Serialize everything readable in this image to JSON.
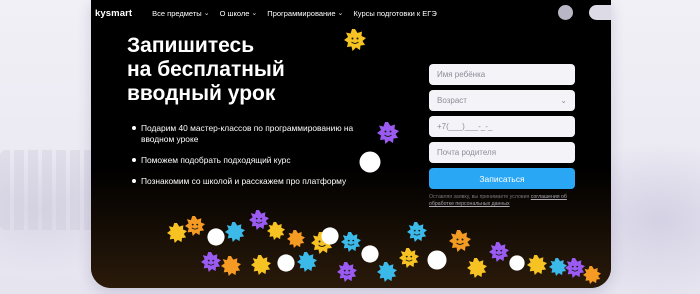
{
  "header": {
    "logo": "kysmart",
    "nav": [
      {
        "label": "Все предметы",
        "chevron": true
      },
      {
        "label": "О школе",
        "chevron": true
      },
      {
        "label": "Программирование",
        "chevron": true
      },
      {
        "label": "Курсы подготовки к ЕГЭ",
        "chevron": false
      }
    ]
  },
  "hero": {
    "title_lines": [
      "Запишитесь",
      "на бесплатный",
      "вводный урок"
    ],
    "benefits": [
      "Подарим 40 мастер-классов по программированию на вводном уроке",
      "Поможем подобрать подходящий курс",
      "Познакомим со школой и расскажем про платформу"
    ]
  },
  "form": {
    "name_placeholder": "Имя ребёнка",
    "age_placeholder": "Возраст",
    "phone_placeholder": "+7(___)___-_-_",
    "email_placeholder": "Почта родителя",
    "submit_label": "Записаться",
    "legal_text": "Оставляя заявку, вы принимаете условия ",
    "legal_link": "соглашения об обработке персональных данных"
  },
  "colors": {
    "card_bg": "#000000",
    "accent_blue": "#2aa7f4",
    "blob_yellow": "#f6c323",
    "blob_orange": "#f59a23",
    "blob_purple": "#9b5bf2",
    "blob_cyan": "#3bb9e8",
    "blob_white": "#ffffff"
  }
}
